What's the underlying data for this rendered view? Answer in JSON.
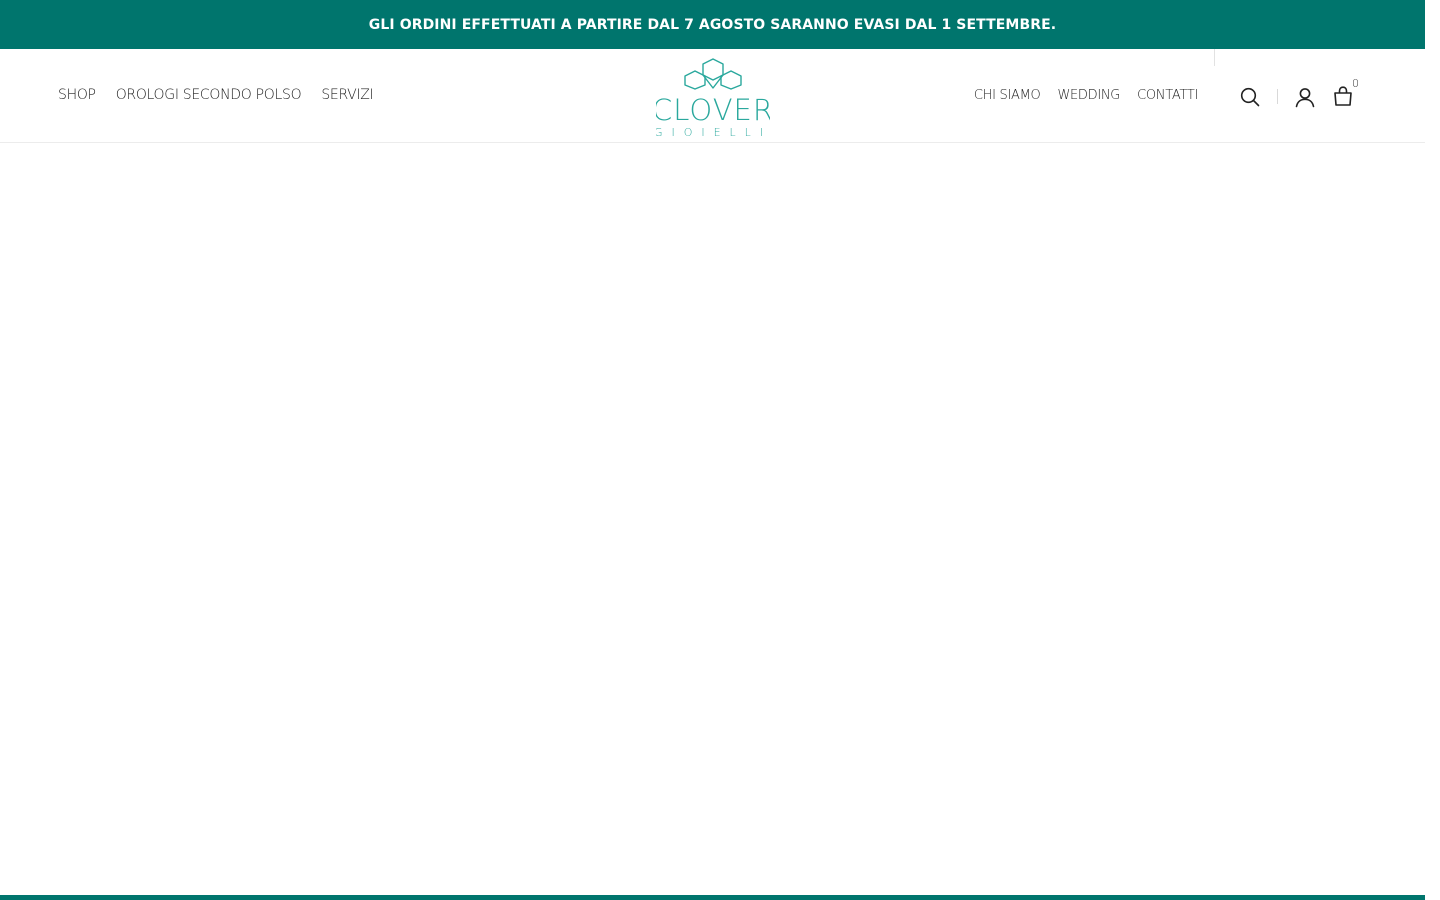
{
  "announcement": {
    "text": "GLI ORDINI EFFETTUATI A PARTIRE DAL 7 AGOSTO SARANNO EVASI DAL 1 SETTEMBRE."
  },
  "header": {
    "nav_left": [
      {
        "label": "SHOP"
      },
      {
        "label": "OROLOGI SECONDO POLSO"
      },
      {
        "label": "SERVIZI"
      }
    ],
    "logo": {
      "brand": "CLOVER",
      "tagline": "GIOIELLI"
    },
    "nav_right": [
      {
        "label": "CHI SIAMO"
      },
      {
        "label": "WEDDING"
      },
      {
        "label": "CONTATTI"
      }
    ],
    "icons": {
      "search": "search-icon",
      "account": "user-icon",
      "cart": "shopping-bag-icon"
    },
    "cart_count": "0"
  },
  "colors": {
    "brand_teal": "#00756d",
    "logo_teal": "#2aa89d",
    "nav_text": "#1f1f1f"
  }
}
